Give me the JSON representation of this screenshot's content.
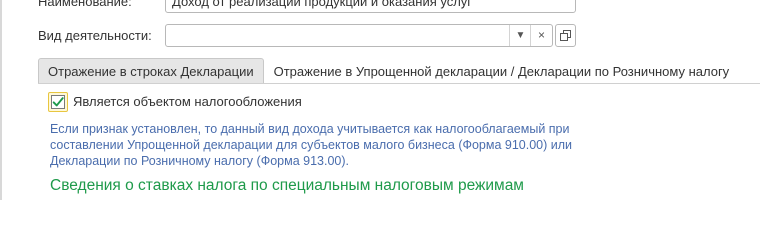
{
  "form": {
    "name_label": "Наименование:",
    "name_value": "Доход от реализации продукции и оказания услуг",
    "activity_label": "Вид деятельности:",
    "activity_value": "",
    "colors": {
      "accent_green": "#1e9a4a",
      "info_blue": "#4a6dad",
      "focus_yellow": "#e8c640"
    }
  },
  "tabs": [
    {
      "label": "Отражение в строках Декларации",
      "active": false
    },
    {
      "label": "Отражение в Упрощенной декларации / Декларации по Розничному налогу",
      "active": true
    }
  ],
  "taxable": {
    "label": "Является объектом налогообложения",
    "checked": true
  },
  "info_lines": [
    "Если признак установлен, то данный вид дохода учитывается как налогооблагаемый при",
    "составлении Упрощенной декларации для субъектов малого бизнеса (Форма 910.00) или",
    "Декларации по Розничному налогу (Форма 913.00)."
  ],
  "section_title": "Сведения о ставках налога по специальным налоговым режимам"
}
